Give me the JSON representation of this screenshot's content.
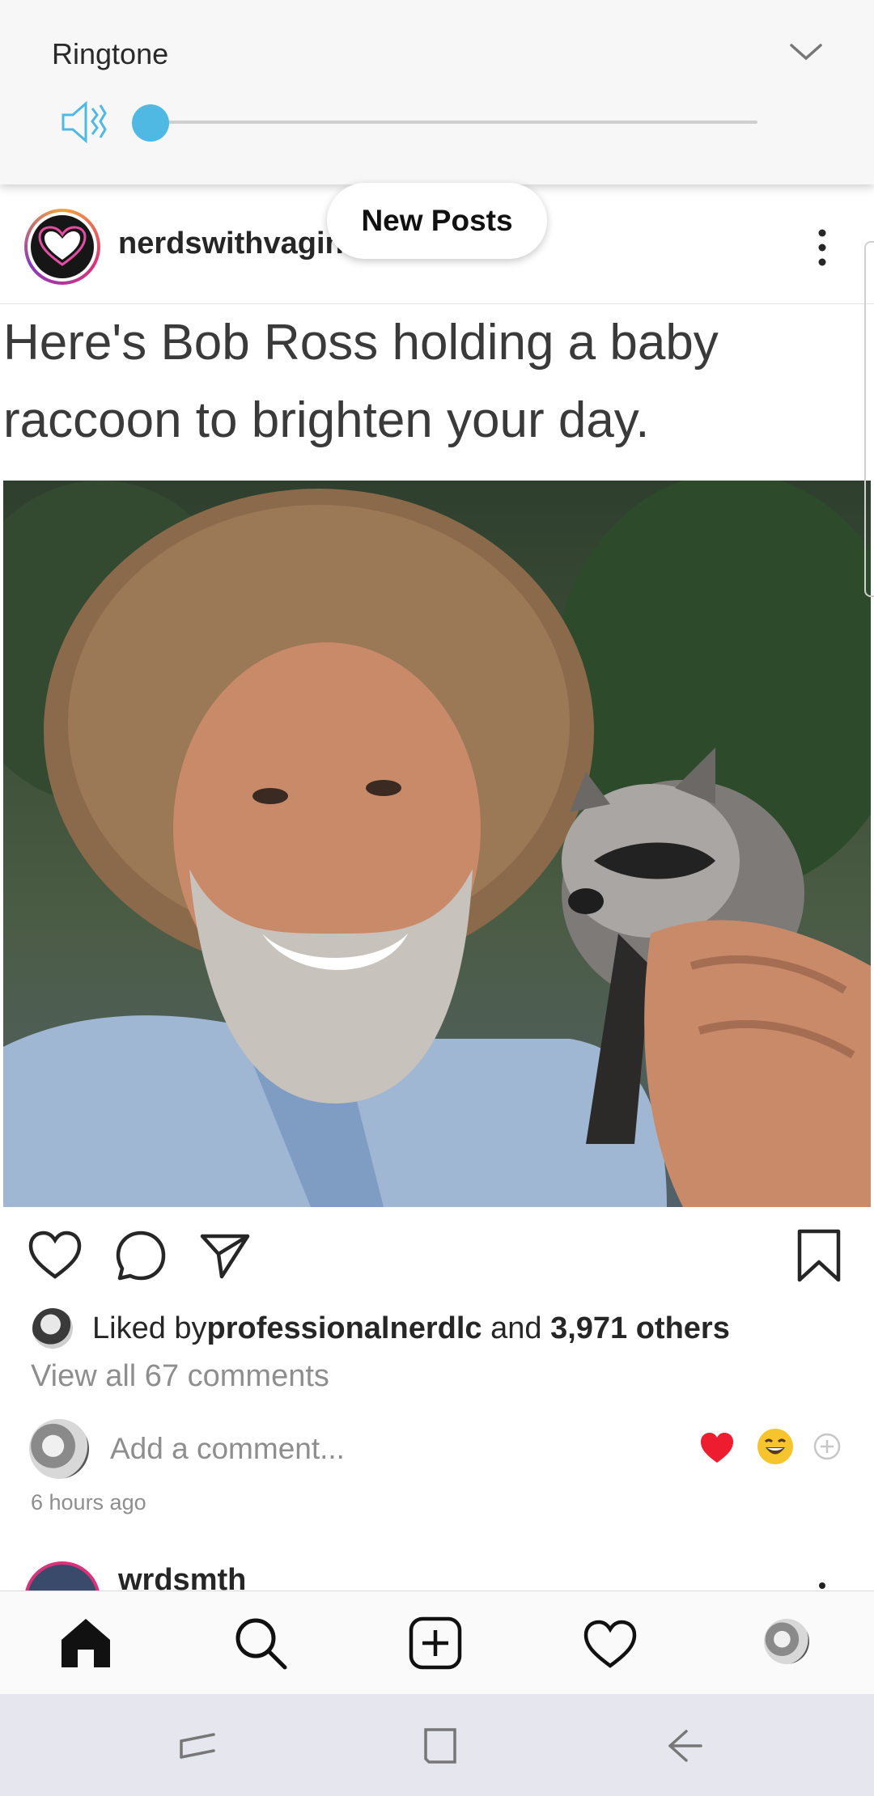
{
  "volume_panel": {
    "label": "Ringtone",
    "level_fraction": 0.0,
    "icons": [
      "mute-icon",
      "chevron-down-icon"
    ]
  },
  "new_posts_label": "New Posts",
  "post": {
    "username": "nerdswithvagina",
    "meme_caption_line1": "Here's Bob Ross holding a baby",
    "meme_caption_line2": "raccoon to brighten your day.",
    "liked_by_prefix": "Liked by ",
    "liked_by_user": "professionalnerdlc",
    "liked_by_mid": " and ",
    "liked_by_others": "3,971 others",
    "view_comments": "View all 67 comments",
    "comment_placeholder": "Add a comment...",
    "timestamp": "6 hours ago"
  },
  "next_post": {
    "username": "wrdsmth"
  },
  "bottom_nav": {
    "items": [
      "home-icon",
      "search-icon",
      "add-post-icon",
      "activity-icon",
      "profile-avatar"
    ]
  },
  "colors": {
    "accent_blue": "#4fb8e3",
    "heart_red": "#ed4956",
    "text": "#262626",
    "muted": "#8e8e8e"
  }
}
